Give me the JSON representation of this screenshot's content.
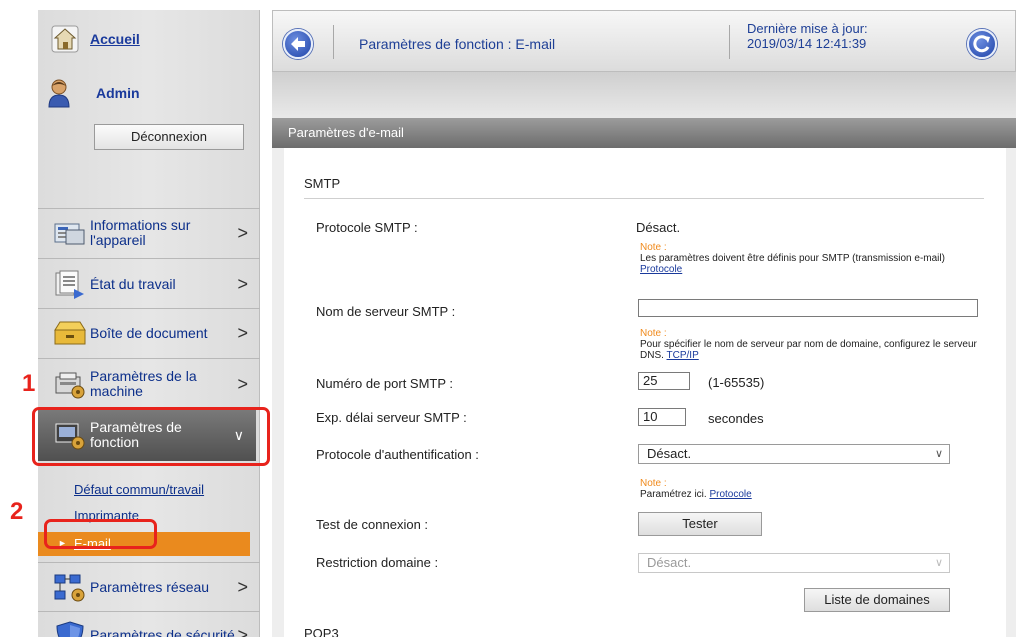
{
  "sidebar": {
    "home": "Accueil",
    "user": "Admin",
    "logout": "Déconnexion",
    "menu": [
      {
        "label": "Informations sur l'appareil"
      },
      {
        "label": "État du travail"
      },
      {
        "label": "Boîte de document"
      },
      {
        "label": "Paramètres de la machine"
      },
      {
        "label": "Paramètres de fonction"
      },
      {
        "label": "Paramètres réseau"
      },
      {
        "label": "Paramètres de sécurité"
      }
    ],
    "submenu": [
      "Défaut commun/travail",
      "Imprimante",
      "E-mail"
    ]
  },
  "annotations": {
    "step1": "1",
    "step2": "2"
  },
  "header": {
    "title": "Paramètres de fonction : E-mail",
    "updated_label": "Dernière mise à jour:",
    "updated_value": "2019/03/14 12:41:39"
  },
  "panel": {
    "title": "Paramètres d'e-mail",
    "smtp_section": "SMTP",
    "pop3_section": "POP3",
    "protocol_label": "Protocole SMTP :",
    "protocol_value": "Désact.",
    "note_label": "Note :",
    "note1_text": "Les paramètres doivent être définis pour SMTP (transmission e-mail)",
    "note1_link": "Protocole",
    "server_label": "Nom de serveur SMTP :",
    "server_value": "",
    "note2_text": "Pour spécifier le nom de serveur par nom de domaine, configurez le serveur DNS.",
    "note2_link": "TCP/IP",
    "port_label": "Numéro de port SMTP :",
    "port_value": "25",
    "port_range": "(1-65535)",
    "timeout_label": "Exp. délai serveur SMTP :",
    "timeout_value": "10",
    "timeout_unit": "secondes",
    "auth_label": "Protocole d'authentification :",
    "auth_value": "Désact.",
    "note3_text": "Paramétrez ici.",
    "note3_link": "Protocole",
    "test_label": "Test de connexion :",
    "test_button": "Tester",
    "domain_label": "Restriction domaine :",
    "domain_value": "Désact.",
    "domain_list_button": "Liste de domaines"
  },
  "colors": {
    "accent_orange": "#ea8a1e",
    "annotation_red": "#e8231c",
    "link_blue": "#1a3a9c"
  }
}
